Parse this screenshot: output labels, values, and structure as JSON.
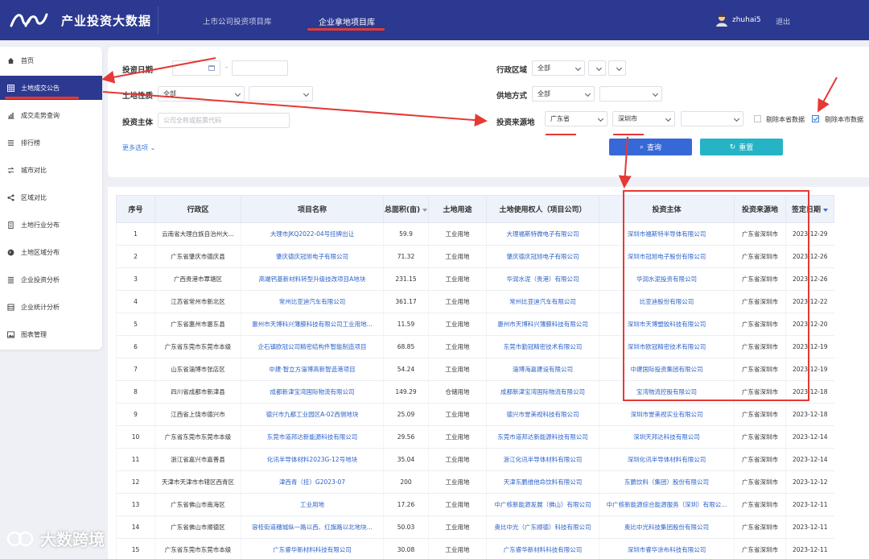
{
  "header": {
    "brand": "产业投资大数据",
    "tabs": [
      {
        "label": "上市公司投资项目库"
      },
      {
        "label": "企业拿地项目库"
      }
    ],
    "user": "zhuhai5",
    "logout": "退出"
  },
  "sidebar": {
    "items": [
      {
        "label": "首页",
        "icon": "home-icon"
      },
      {
        "label": "土地成交公告",
        "icon": "grid-icon"
      },
      {
        "label": "成交走势查询",
        "icon": "bar-chart-icon"
      },
      {
        "label": "排行榜",
        "icon": "list-icon"
      },
      {
        "label": "城市对比",
        "icon": "swap-icon"
      },
      {
        "label": "区域对比",
        "icon": "share-icon"
      },
      {
        "label": "土地行业分布",
        "icon": "document-icon"
      },
      {
        "label": "土地区域分布",
        "icon": "globe-icon"
      },
      {
        "label": "企业投资分析",
        "icon": "list-icon"
      },
      {
        "label": "企业统计分析",
        "icon": "list-icon"
      },
      {
        "label": "图表管理",
        "icon": "image-icon"
      }
    ]
  },
  "filters": {
    "date_label": "投资日期",
    "dash": "-",
    "region_label": "行政区域",
    "region_value": "全部",
    "land_nature_label": "土地性质",
    "land_nature_value": "全部",
    "supply_label": "供地方式",
    "supply_value": "全部",
    "investor_label": "投资主体",
    "investor_placeholder": "公司全称或股票代码",
    "source_label": "投资来源地",
    "source_province": "广东省",
    "source_city": "深圳市",
    "exclude_province": "剔除本省数据",
    "exclude_city": "剔除本市数据",
    "more": "更多选项",
    "query": "查询",
    "reset": "重置"
  },
  "table": {
    "headers": [
      "序号",
      "行政区",
      "项目名称",
      "总面积(亩)",
      "土地用途",
      "土地使用权人（项目公司）",
      "投资主体",
      "投资来源地",
      "签定日期"
    ],
    "rows": [
      [
        "1",
        "云南省大理白族自治州大...",
        "大理市JKQ2022-04号挂牌出让",
        "59.9",
        "工业用地",
        "大理福斯特微电子有限公司",
        "深圳市福斯特半导体有限公司",
        "广东省深圳市",
        "2023-12-29"
      ],
      [
        "2",
        "广东省肇庆市德庆县",
        "肇庆德庆冠旭电子有限公司",
        "71.32",
        "工业用地",
        "肇庆德庆冠旭电子有限公司",
        "深圳市冠旭电子股份有限公司",
        "广东省深圳市",
        "2023-12-26"
      ],
      [
        "3",
        "广西贵港市覃塘区",
        "高端钙基新材料转型升级技改项目A地块",
        "231.15",
        "工业用地",
        "华润水泥（贵港）有限公司",
        "华润水泥投资有限公司",
        "广东省深圳市",
        "2023-12-26"
      ],
      [
        "4",
        "江苏省常州市新北区",
        "常州比亚迪汽车有限公司",
        "361.17",
        "工业用地",
        "常州比亚迪汽车有限公司",
        "比亚迪股份有限公司",
        "广东省深圳市",
        "2023-12-22"
      ],
      [
        "5",
        "广东省惠州市惠东县",
        "惠州市天博科兴薄膜科技有限公司工业用地...",
        "11.59",
        "工业用地",
        "惠州市天博科兴薄膜科技有限公司",
        "深圳市天博塑胶科技有限公司",
        "广东省深圳市",
        "2023-12-20"
      ],
      [
        "6",
        "广东省东莞市东莞市本级",
        "企石镇欧冠公司精密结构件智能制造项目",
        "68.85",
        "工业用地",
        "东莞市勤冠精密技术有限公司",
        "深圳市欧冠精密技术有限公司",
        "广东省深圳市",
        "2023-12-19"
      ],
      [
        "7",
        "山东省淄博市张店区",
        "中建·智立方淄博高新智造港项目",
        "54.24",
        "工业用地",
        "淄博海嘉建设有限公司",
        "中建国际投资集团有限公司",
        "广东省深圳市",
        "2023-12-19"
      ],
      [
        "8",
        "四川省成都市新津县",
        "成都新津宝湾国际物流有限公司",
        "149.29",
        "仓储用地",
        "成都新津宝湾国际物流有限公司",
        "宝湾物流控股有限公司",
        "广东省深圳市",
        "2023-12-18"
      ],
      [
        "9",
        "江西省上饶市德兴市",
        "德兴市九都工业园区A-02西侧地块",
        "25.09",
        "工业用地",
        "德兴市誉美视科技有限公司",
        "深圳市誉美视实业有限公司",
        "广东省深圳市",
        "2023-12-18"
      ],
      [
        "10",
        "广东省东莞市东莞市本级",
        "东莞市道邦达新能源科技有限公司",
        "29.56",
        "工业用地",
        "东莞市道邦达新能源科技有限公司",
        "深圳天邦达科技有限公司",
        "广东省深圳市",
        "2023-12-14"
      ],
      [
        "11",
        "浙江省嘉兴市嘉善县",
        "化讯半导体材料2023G-12号地块",
        "35.04",
        "工业用地",
        "浙江化讯半导体材料有限公司",
        "深圳化讯半导体材料有限公司",
        "广东省深圳市",
        "2023-12-14"
      ],
      [
        "12",
        "天津市天津市市辖区西青区",
        "津西青（挂）G2023-07",
        "200",
        "工业用地",
        "天津东鹏维他命饮料有限公司",
        "东鹏饮料（集团）股份有限公司",
        "广东省深圳市",
        "2023-12-12"
      ],
      [
        "13",
        "广东省佛山市南海区",
        "工业用地",
        "17.26",
        "工业用地",
        "中广核新能源发展（佛山）有限公司",
        "中广核新能源综合能源服务（深圳）有限公...",
        "广东省深圳市",
        "2023-12-11"
      ],
      [
        "14",
        "广东省佛山市顺德区",
        "容桂街道穗城纵一路以西、红旗路以北地块...",
        "50.03",
        "工业用地",
        "奥比中光（广东顺德）科技有限公司",
        "奥比中光科技集团股份有限公司",
        "广东省深圳市",
        "2023-12-11"
      ],
      [
        "15",
        "广东省东莞市东莞市本级",
        "广东睿华新材料科技有限公司",
        "30.08",
        "工业用地",
        "广东睿华新材料科技有限公司",
        "深圳市睿华涂布科技有限公司",
        "广东省深圳市",
        "2023-12-11"
      ]
    ]
  },
  "watermark": "大数跨境",
  "colors": {
    "primary": "#2b3990",
    "accent": "#e53935",
    "link": "#2b62c8",
    "query": "#3768d8",
    "reset": "#26b3c6"
  }
}
